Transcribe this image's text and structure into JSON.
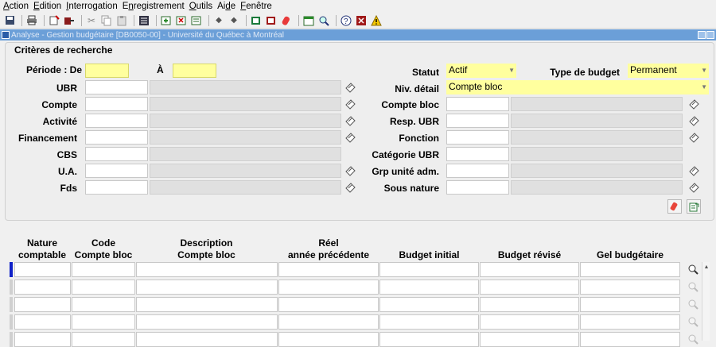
{
  "menubar": [
    {
      "pre": "",
      "ul": "A",
      "post": "ction"
    },
    {
      "pre": "",
      "ul": "E",
      "post": "dition"
    },
    {
      "pre": "",
      "ul": "I",
      "post": "nterrogation"
    },
    {
      "pre": "E",
      "ul": "n",
      "post": "registrement"
    },
    {
      "pre": "",
      "ul": "O",
      "post": "utils"
    },
    {
      "pre": "Ai",
      "ul": "d",
      "post": "e"
    },
    {
      "pre": "",
      "ul": "F",
      "post": "enêtre"
    }
  ],
  "window": {
    "title": "Analyse - Gestion budgétaire [DB0050-00] - Université du Québec à Montréal"
  },
  "criteria": {
    "title": "Critères de recherche",
    "periode_label": "Période : De",
    "a_label": "À",
    "periode_de": "",
    "periode_a": "",
    "statut_label": "Statut",
    "statut_value": "Actif",
    "type_budget_label": "Type de budget",
    "type_budget_value": "Permanent",
    "niv_detail_label": "Niv. détail",
    "niv_detail_value": "Compte bloc",
    "left_fields": [
      {
        "label": "UBR",
        "code": "",
        "desc": ""
      },
      {
        "label": "Compte",
        "code": "",
        "desc": ""
      },
      {
        "label": "Activité",
        "code": "",
        "desc": ""
      },
      {
        "label": "Financement",
        "code": "",
        "desc": ""
      },
      {
        "label": "CBS",
        "code": "",
        "desc": ""
      },
      {
        "label": "U.A.",
        "code": "",
        "desc": ""
      },
      {
        "label": "Fds",
        "code": "",
        "desc": ""
      }
    ],
    "right_fields": [
      {
        "label": "Compte bloc",
        "code": "",
        "desc": ""
      },
      {
        "label": "Resp. UBR",
        "code": "",
        "desc": ""
      },
      {
        "label": "Fonction",
        "code": "",
        "desc": ""
      },
      {
        "label": "Catégorie UBR",
        "code": "",
        "desc": ""
      },
      {
        "label": "Grp unité adm.",
        "code": "",
        "desc": ""
      },
      {
        "label": "Sous nature",
        "code": "",
        "desc": ""
      }
    ]
  },
  "grid": {
    "headers": {
      "nature_l1": "Nature",
      "nature_l2": "comptable",
      "code_l1": "Code",
      "code_l2": "Compte bloc",
      "desc_l1": "Description",
      "desc_l2": "Compte bloc",
      "reel_l1": "Réel",
      "reel_l2": "année précédente",
      "budget_initial": "Budget initial",
      "budget_revise": "Budget révisé",
      "gel_budgetaire": "Gel budgétaire"
    },
    "rows": [
      [
        "",
        "",
        "",
        "",
        "",
        "",
        ""
      ],
      [
        "",
        "",
        "",
        "",
        "",
        "",
        ""
      ],
      [
        "",
        "",
        "",
        "",
        "",
        "",
        ""
      ],
      [
        "",
        "",
        "",
        "",
        "",
        "",
        ""
      ],
      [
        "",
        "",
        "",
        "",
        "",
        "",
        ""
      ]
    ]
  },
  "icons": {
    "lov": "list-of-values-icon",
    "erase": "eraser-icon",
    "export": "export-icon",
    "zoom": "magnifier-icon"
  }
}
